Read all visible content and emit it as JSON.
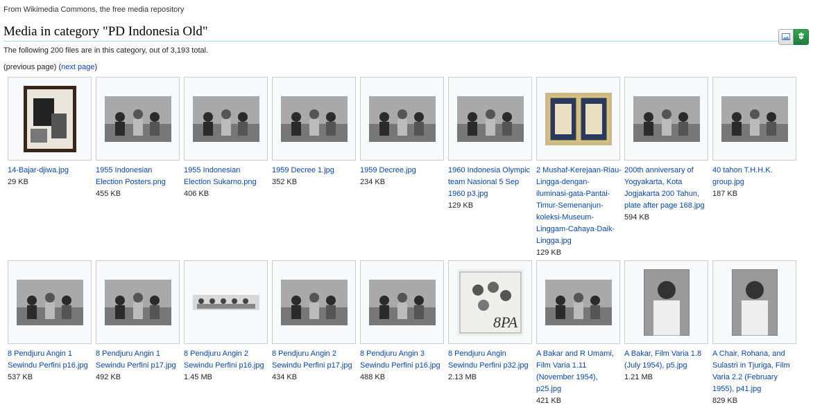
{
  "site_sub": "From Wikimedia Commons, the free media repository",
  "title": "Media in category \"PD Indonesia Old\"",
  "summary": "The following 200 files are in this category, out of 3,193 total.",
  "pager": {
    "prev_label": "previous page",
    "next_label": "next page"
  },
  "view_toggle": {
    "left_icon": "image-icon",
    "right_icon": "expand-icon",
    "accent": "#2a9146"
  },
  "files": [
    {
      "name": "14-Bajar-djiwa.jpg",
      "size": "29 KB",
      "icon": "portrait-poster"
    },
    {
      "name": "1955 Indonesian Election Posters.png",
      "size": "455 KB",
      "icon": "landscape-photo"
    },
    {
      "name": "1955 Indonesian Election Sukarno.png",
      "size": "406 KB",
      "icon": "landscape-photo"
    },
    {
      "name": "1959 Decree 1.jpg",
      "size": "352 KB",
      "icon": "landscape-photo"
    },
    {
      "name": "1959 Decree.jpg",
      "size": "234 KB",
      "icon": "landscape-photo"
    },
    {
      "name": "1960 Indonesia Olympic team Nasional 5 Sep 1960 p3.jpg",
      "size": "129 KB",
      "icon": "landscape-photo"
    },
    {
      "name": "2 Mushaf-Kerejaan-Riau-Lingga-dengan-iluminasi-gata-Pantai-Timur-Semenanjun-koleksi-Museum-Linggam-Cahaya-Daik-Lingga.jpg",
      "size": "129 KB",
      "icon": "manuscript"
    },
    {
      "name": "200th anniversary of Yogyakarta, Kota Jogjakarta 200 Tahun, plate after page 168.jpg",
      "size": "594 KB",
      "icon": "landscape-photo"
    },
    {
      "name": "40 tahon T.H.H.K. group.jpg",
      "size": "187 KB",
      "icon": "landscape-photo"
    },
    {
      "name": "8 Pendjuru Angin 1 Sewindu Perfini p16.jpg",
      "size": "537 KB",
      "icon": "landscape-photo"
    },
    {
      "name": "8 Pendjuru Angin 1 Sewindu Perfini p17.jpg",
      "size": "492 KB",
      "icon": "landscape-photo"
    },
    {
      "name": "8 Pendjuru Angin 2 Sewindu Perfini p16.jpg",
      "size": "1.45 MB",
      "icon": "strip-photo"
    },
    {
      "name": "8 Pendjuru Angin 2 Sewindu Perfini p17.jpg",
      "size": "434 KB",
      "icon": "landscape-photo"
    },
    {
      "name": "8 Pendjuru Angin 3 Sewindu Perfini p16.jpg",
      "size": "488 KB",
      "icon": "landscape-photo"
    },
    {
      "name": "8 Pendjuru Angin Sewindu Perfini p32.jpg",
      "size": "2.13 MB",
      "icon": "poster"
    },
    {
      "name": "A Bakar and R Umami, Film Varia 1.11 (November 1954), p25.jpg",
      "size": "421 KB",
      "icon": "landscape-photo"
    },
    {
      "name": "A Bakar, Film Varia 1.8 (July 1954), p5.jpg",
      "size": "1.21 MB",
      "icon": "portrait-photo"
    },
    {
      "name": "A Chair, Rohana, and Sulastri in Tjuriga, Film Varia 2.2 (February 1955), p41.jpg",
      "size": "829 KB",
      "icon": "portrait-photo"
    }
  ]
}
